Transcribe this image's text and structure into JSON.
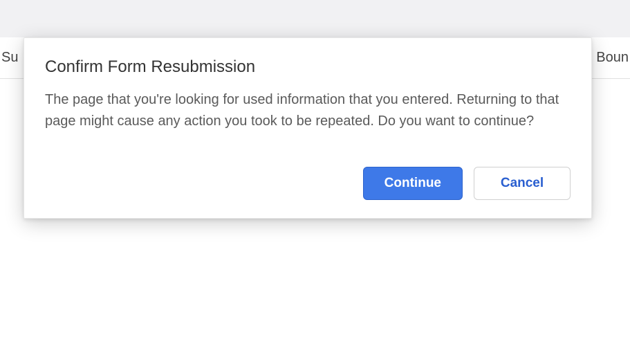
{
  "background": {
    "tab_left_fragment": "Su",
    "tab_right_fragment": "Boun"
  },
  "dialog": {
    "title": "Confirm Form Resubmission",
    "body": "The page that you're looking for used information that you entered. Returning to that page might cause any action you took to be repeated. Do you want to continue?",
    "continue_label": "Continue",
    "cancel_label": "Cancel"
  }
}
